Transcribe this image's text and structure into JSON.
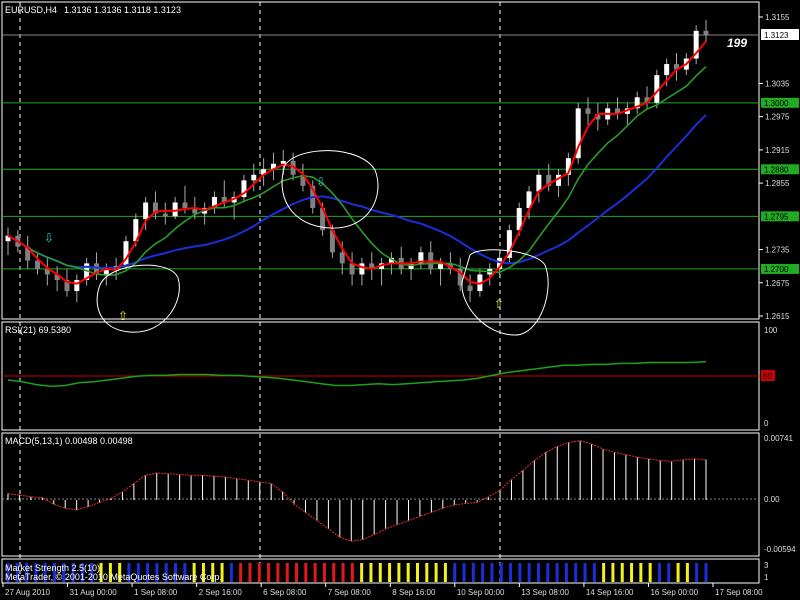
{
  "main": {
    "symbol": "EURUSD,H4",
    "ohlc": "1.3136 1.3136 1.3118 1.3123",
    "price_ticks": [
      "1.3155",
      "1.3035",
      "1.2975",
      "1.2915",
      "1.2855",
      "1.2735",
      "1.2675",
      "1.2615"
    ],
    "highlight_levels": [
      "1.3000",
      "1.2880",
      "1.2795",
      "1.2700"
    ],
    "current_price": "1.3123",
    "big_number": "199",
    "colors": {
      "bull": "#ffffff",
      "bear": "#808080",
      "ma_fast": "#ff0000",
      "ma_slow": "#2a9a2a",
      "ma_long": "#1a2fd8",
      "level_line": "#21a821",
      "badge_green": "#22aa22"
    }
  },
  "rsi": {
    "label": "RSI(21) 69.5380",
    "ticks": [
      "100",
      "0"
    ],
    "level_badge": "50"
  },
  "macd": {
    "label": "MACD(5,13,1) 0.00498 0.00498",
    "ticks": [
      "0.00741",
      "0.00",
      "-0.00594"
    ]
  },
  "strength": {
    "label": "Market Strength 2.5(10)",
    "copyright": "MetaTrader, © 2001-2010 MetaQuotes Software Corp.",
    "ticks": [
      "3",
      "1"
    ]
  },
  "time_axis": [
    "27 Aug 2010",
    "31 Aug 00:00",
    "1 Sep 08:00",
    "2 Sep 16:00",
    "6 Sep 08:00",
    "7 Sep 08:00",
    "8 Sep 16:00",
    "10 Sep 00:00",
    "13 Sep 08:00",
    "14 Sep 16:00",
    "16 Sep 00:00",
    "17 Sep 08:00"
  ],
  "chart_data": {
    "type": "candlestick",
    "price_range": [
      1.2615,
      1.3155
    ],
    "candles": [
      [
        1.275,
        1.2775,
        1.2725,
        1.276
      ],
      [
        1.276,
        1.277,
        1.273,
        1.274
      ],
      [
        1.274,
        1.276,
        1.27,
        1.2715
      ],
      [
        1.2715,
        1.273,
        1.269,
        1.27
      ],
      [
        1.27,
        1.272,
        1.267,
        1.269
      ],
      [
        1.269,
        1.2705,
        1.266,
        1.268
      ],
      [
        1.268,
        1.27,
        1.265,
        1.266
      ],
      [
        1.266,
        1.269,
        1.264,
        1.268
      ],
      [
        1.268,
        1.272,
        1.267,
        1.271
      ],
      [
        1.271,
        1.273,
        1.268,
        1.269
      ],
      [
        1.269,
        1.271,
        1.267,
        1.27
      ],
      [
        1.27,
        1.272,
        1.268,
        1.2705
      ],
      [
        1.2705,
        1.276,
        1.27,
        1.275
      ],
      [
        1.275,
        1.28,
        1.274,
        1.279
      ],
      [
        1.279,
        1.283,
        1.277,
        1.282
      ],
      [
        1.282,
        1.284,
        1.279,
        1.28
      ],
      [
        1.28,
        1.282,
        1.278,
        1.2795
      ],
      [
        1.2795,
        1.283,
        1.279,
        1.282
      ],
      [
        1.282,
        1.285,
        1.28,
        1.281
      ],
      [
        1.281,
        1.283,
        1.279,
        1.28
      ],
      [
        1.28,
        1.282,
        1.278,
        1.281
      ],
      [
        1.281,
        1.284,
        1.28,
        1.283
      ],
      [
        1.283,
        1.286,
        1.281,
        1.282
      ],
      [
        1.282,
        1.284,
        1.279,
        1.283
      ],
      [
        1.283,
        1.287,
        1.282,
        1.286
      ],
      [
        1.286,
        1.289,
        1.284,
        1.287
      ],
      [
        1.287,
        1.29,
        1.285,
        1.288
      ],
      [
        1.288,
        1.291,
        1.286,
        1.289
      ],
      [
        1.289,
        1.2915,
        1.287,
        1.2895
      ],
      [
        1.2895,
        1.291,
        1.286,
        1.287
      ],
      [
        1.287,
        1.289,
        1.284,
        1.285
      ],
      [
        1.285,
        1.286,
        1.28,
        1.281
      ],
      [
        1.281,
        1.282,
        1.276,
        1.277
      ],
      [
        1.277,
        1.278,
        1.272,
        1.273
      ],
      [
        1.273,
        1.275,
        1.269,
        1.271
      ],
      [
        1.271,
        1.273,
        1.267,
        1.269
      ],
      [
        1.269,
        1.272,
        1.267,
        1.271
      ],
      [
        1.271,
        1.273,
        1.268,
        1.27
      ],
      [
        1.27,
        1.272,
        1.267,
        1.271
      ],
      [
        1.271,
        1.273,
        1.269,
        1.272
      ],
      [
        1.272,
        1.274,
        1.269,
        1.27
      ],
      [
        1.27,
        1.272,
        1.268,
        1.271
      ],
      [
        1.271,
        1.274,
        1.27,
        1.273
      ],
      [
        1.273,
        1.275,
        1.269,
        1.27
      ],
      [
        1.27,
        1.272,
        1.267,
        1.271
      ],
      [
        1.271,
        1.273,
        1.269,
        1.27
      ],
      [
        1.27,
        1.272,
        1.266,
        1.267
      ],
      [
        1.267,
        1.269,
        1.264,
        1.266
      ],
      [
        1.266,
        1.27,
        1.265,
        1.269
      ],
      [
        1.269,
        1.271,
        1.267,
        1.27
      ],
      [
        1.27,
        1.273,
        1.269,
        1.272
      ],
      [
        1.272,
        1.278,
        1.271,
        1.277
      ],
      [
        1.277,
        1.282,
        1.276,
        1.281
      ],
      [
        1.281,
        1.285,
        1.279,
        1.284
      ],
      [
        1.284,
        1.288,
        1.282,
        1.287
      ],
      [
        1.287,
        1.289,
        1.284,
        1.285
      ],
      [
        1.285,
        1.288,
        1.283,
        1.287
      ],
      [
        1.287,
        1.291,
        1.285,
        1.29
      ],
      [
        1.29,
        1.3,
        1.289,
        1.299
      ],
      [
        1.299,
        1.301,
        1.296,
        1.298
      ],
      [
        1.298,
        1.3,
        1.295,
        1.297
      ],
      [
        1.297,
        1.3,
        1.296,
        1.299
      ],
      [
        1.299,
        1.301,
        1.297,
        1.298
      ],
      [
        1.298,
        1.3,
        1.296,
        1.299
      ],
      [
        1.299,
        1.302,
        1.298,
        1.301
      ],
      [
        1.301,
        1.303,
        1.299,
        1.3
      ],
      [
        1.3,
        1.306,
        1.299,
        1.305
      ],
      [
        1.305,
        1.308,
        1.303,
        1.307
      ],
      [
        1.307,
        1.309,
        1.304,
        1.306
      ],
      [
        1.306,
        1.309,
        1.305,
        1.308
      ],
      [
        1.308,
        1.314,
        1.307,
        1.313
      ],
      [
        1.313,
        1.315,
        1.311,
        1.3123
      ]
    ],
    "macd_range": [
      -0.00594,
      0.00741
    ],
    "macd": [
      0.0008,
      0.0006,
      0.0004,
      0.0003,
      -0.0005,
      -0.001,
      -0.0012,
      -0.0008,
      -0.0003,
      0.0002,
      0.001,
      0.002,
      0.003,
      0.0033,
      0.0032,
      0.0031,
      0.003,
      0.003,
      0.0029,
      0.0028,
      0.0026,
      0.0024,
      0.0022,
      0.002,
      0.001,
      -0.0005,
      -0.0015,
      -0.0025,
      -0.0035,
      -0.0045,
      -0.005,
      -0.0048,
      -0.0042,
      -0.0035,
      -0.003,
      -0.0025,
      -0.002,
      -0.0015,
      -0.001,
      -0.0006,
      -0.0004,
      -0.0003,
      0.0004,
      0.0012,
      0.0025,
      0.0036,
      0.0048,
      0.0058,
      0.0065,
      0.007,
      0.0072,
      0.0068,
      0.0062,
      0.0058,
      0.0055,
      0.0052,
      0.005,
      0.0048,
      0.0047,
      0.0049,
      0.005,
      0.0049
    ],
    "rsi_range": [
      0,
      100
    ],
    "rsi": [
      50,
      48,
      45,
      43,
      44,
      47,
      48,
      50,
      52,
      54,
      55,
      55,
      56,
      56,
      56,
      55,
      55,
      54,
      53,
      52,
      50,
      48,
      46,
      44,
      44,
      45,
      46,
      45,
      46,
      47,
      48,
      49,
      50,
      52,
      55,
      58,
      60,
      62,
      64,
      66,
      66,
      67,
      67,
      68,
      68,
      69,
      69,
      69,
      69,
      70
    ],
    "strength": [
      "b",
      "b",
      "b",
      "b",
      "b",
      "b",
      "b",
      "b",
      "b",
      "b",
      "y",
      "y",
      "y",
      "b",
      "b",
      "b",
      "b",
      "b",
      "b",
      "b",
      "y",
      "y",
      "y",
      "y",
      "b",
      "r",
      "r",
      "r",
      "r",
      "r",
      "r",
      "r",
      "r",
      "r",
      "r",
      "r",
      "r",
      "r",
      "y",
      "y",
      "y",
      "y",
      "y",
      "y",
      "y",
      "y",
      "y",
      "y",
      "b",
      "b",
      "b",
      "b",
      "b",
      "b",
      "b",
      "b",
      "b",
      "b",
      "b",
      "b",
      "b",
      "b",
      "b",
      "b",
      "y",
      "y",
      "y",
      "y",
      "y",
      "y",
      "b",
      "b",
      "y",
      "y",
      "b",
      "b"
    ]
  }
}
